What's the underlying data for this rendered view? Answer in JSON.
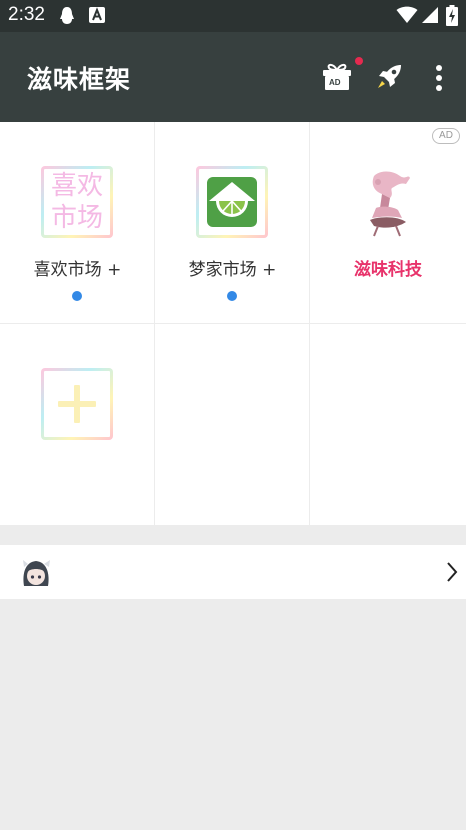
{
  "status_bar": {
    "time": "2:32",
    "icons": [
      "qq-notification-icon",
      "app-notification-icon",
      "wifi-icon",
      "signal-icon",
      "battery-charging-icon"
    ]
  },
  "app_bar": {
    "title": "滋味框架",
    "actions": [
      "gift-ad-icon",
      "rocket-icon",
      "more-vert-icon"
    ],
    "gift_badge_text": "AD",
    "accent_dot_color": "#e52a4f"
  },
  "grid": {
    "ad_badge": "AD",
    "items": [
      {
        "label": "喜欢市场 +",
        "icon": "market-text-icon",
        "icon_text": "喜欢市场",
        "has_dot": true
      },
      {
        "label": "梦家市场 +",
        "icon": "lime-house-icon",
        "has_dot": true
      },
      {
        "label": "滋味科技",
        "icon": "sakura-figure-icon",
        "brand": true,
        "has_dot": false
      },
      {
        "label": "",
        "icon": "add-plus-icon",
        "has_dot": false
      },
      {
        "label": "",
        "icon": "",
        "has_dot": false
      },
      {
        "label": "",
        "icon": "",
        "has_dot": false
      }
    ],
    "dot_color": "#3389e6",
    "brand_color": "#e8336b"
  },
  "profile_row": {
    "avatar": "anime-avatar-icon",
    "chevron": "chevron-right-icon"
  }
}
